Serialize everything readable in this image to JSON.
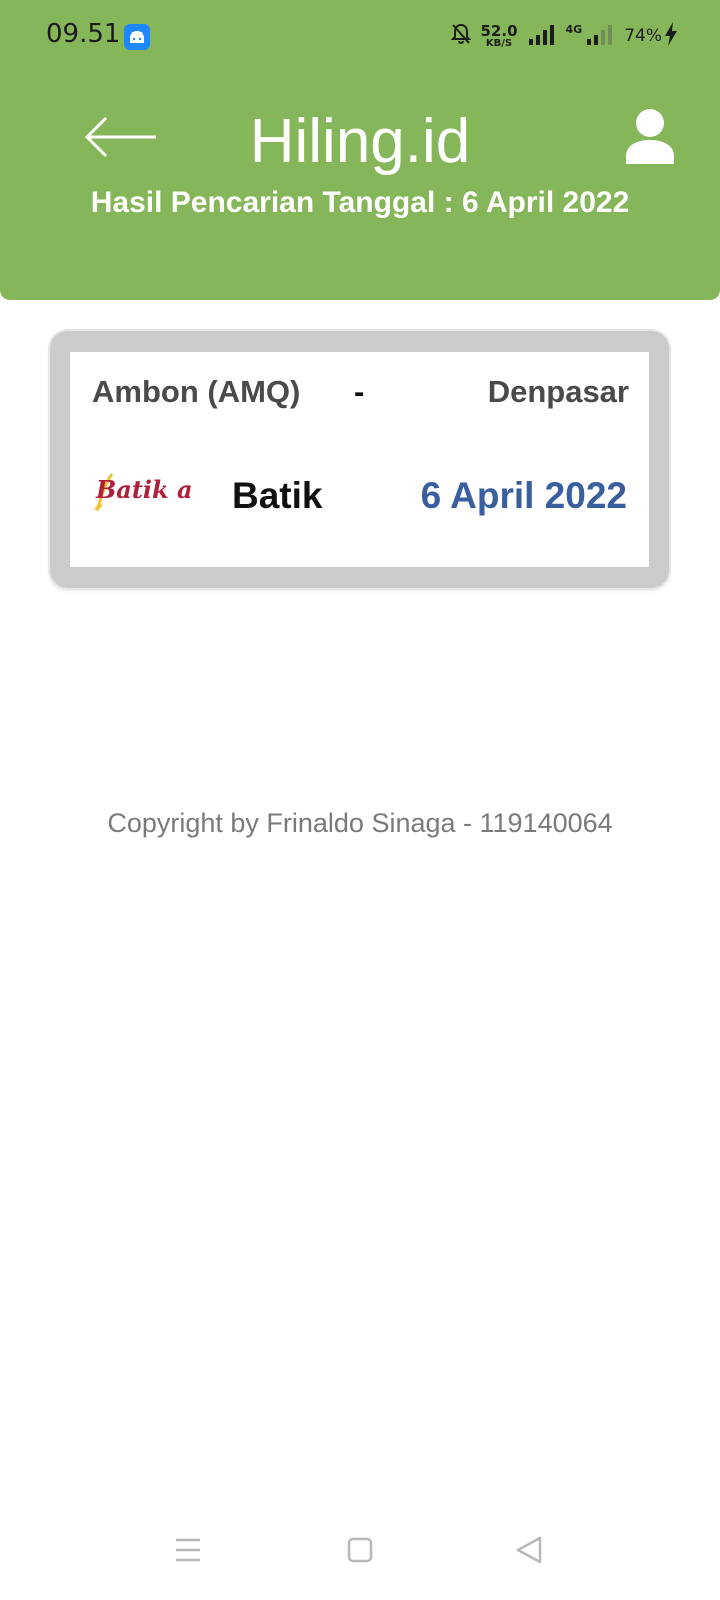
{
  "status_bar": {
    "time": "09.51",
    "net_speed_value": "52.0",
    "net_speed_unit": "KB/S",
    "network_type": "4G",
    "battery": "74%",
    "icons": [
      "android-notification-icon",
      "bell-off-icon",
      "signal-icon",
      "signal-4g-icon",
      "charging-icon"
    ]
  },
  "header": {
    "app_title": "Hiling.id",
    "subtitle": "Hasil Pencarian Tanggal : 6 April 2022",
    "back_icon": "back-arrow-icon",
    "profile_icon": "user-profile-icon",
    "background_color": "#86b65a"
  },
  "result": {
    "origin": "Ambon (AMQ)",
    "separator": "-",
    "destination": "Denpasar",
    "airline_logo_text": "Batik air",
    "airline_name": "Batik",
    "date": "6 April 2022",
    "date_color": "#3a5f9e"
  },
  "footer": {
    "copyright": "Copyright by Frinaldo Sinaga - 119140064"
  },
  "nav_bar": {
    "icons": [
      "menu-icon",
      "home-square-icon",
      "back-triangle-icon"
    ]
  }
}
